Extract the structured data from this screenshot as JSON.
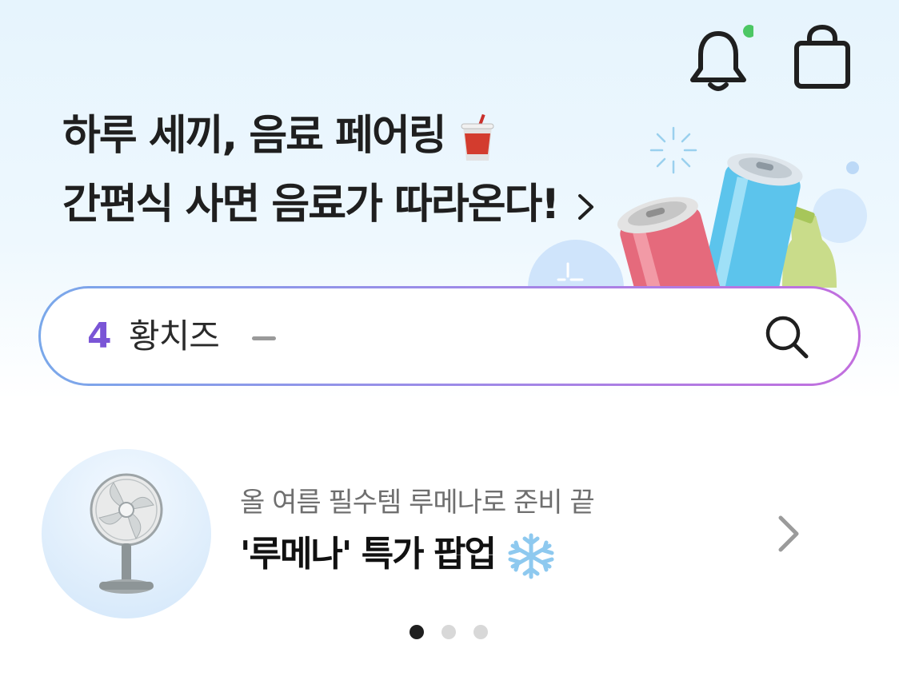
{
  "header": {
    "notification_icon": "bell-icon",
    "notification_badge_color": "#4cc764",
    "cart_icon": "shopping-bag-icon"
  },
  "banner": {
    "line1": "하루 세끼, 음료 페어링",
    "line1_emoji": "🥤",
    "line2": "간편식 사면 음료가 따라온다!",
    "chevron_icon": "chevron-right-icon"
  },
  "search": {
    "rank": "4",
    "keyword": "황치즈",
    "trend": "–",
    "icon": "search-icon"
  },
  "promo": {
    "subtitle": "올 여름 필수템 루메나로 준비 끝",
    "title": "'루메나' 특가 팝업",
    "title_emoji": "❄️",
    "thumbnail_icon": "desk-fan-icon",
    "chevron_icon": "chevron-right-icon"
  },
  "carousel": {
    "pages": 3,
    "current": 1
  },
  "colors": {
    "accent_purple": "#7a55d6",
    "search_gradient_start": "#7aa8ea",
    "search_gradient_end": "#c26ede"
  }
}
